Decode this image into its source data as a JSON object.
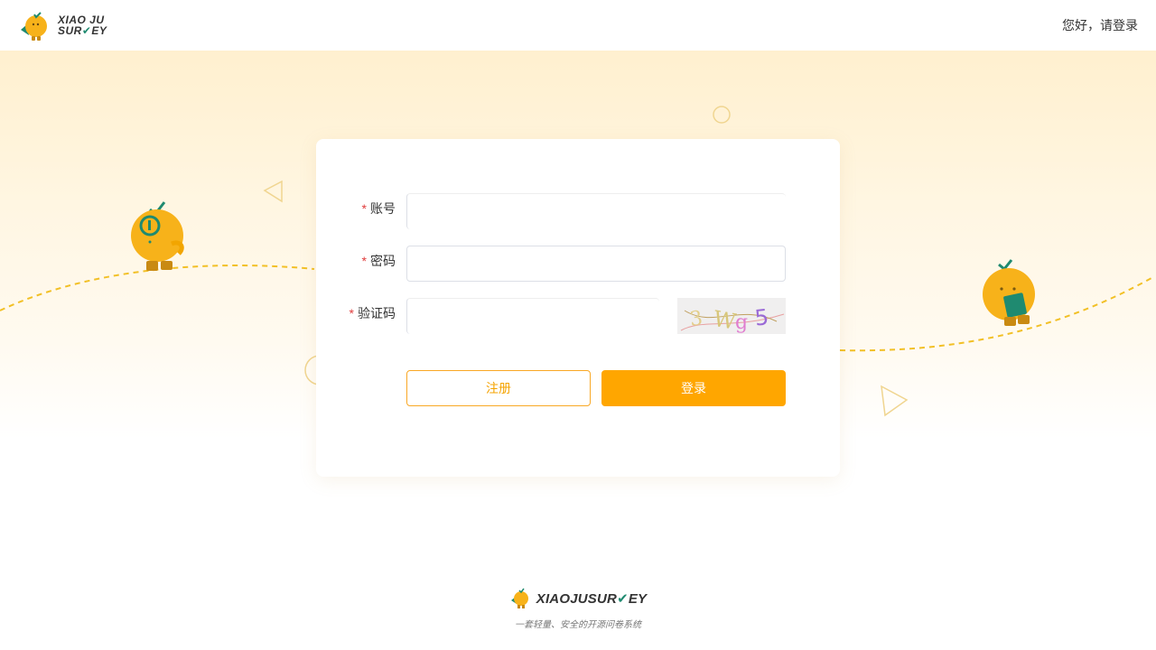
{
  "header": {
    "logo_line1": "XIAO JU",
    "logo_line2a": "SUR",
    "logo_line2b": "EY",
    "greeting": "您好，请登录"
  },
  "form": {
    "account_label": "账号",
    "password_label": "密码",
    "captcha_label": "验证码",
    "required_mark": "*",
    "account_value": "",
    "password_value": "",
    "captcha_value": "",
    "captcha_text": "3Wg5",
    "register_label": "注册",
    "login_label": "登录"
  },
  "footer": {
    "brand_a": "XIAOJUSUR",
    "brand_b": "EY",
    "tagline": "一套轻量、安全的开源问卷系统"
  },
  "colors": {
    "accent": "#ffa600",
    "brand_green": "#1f8a70",
    "required": "#e03c3c"
  }
}
